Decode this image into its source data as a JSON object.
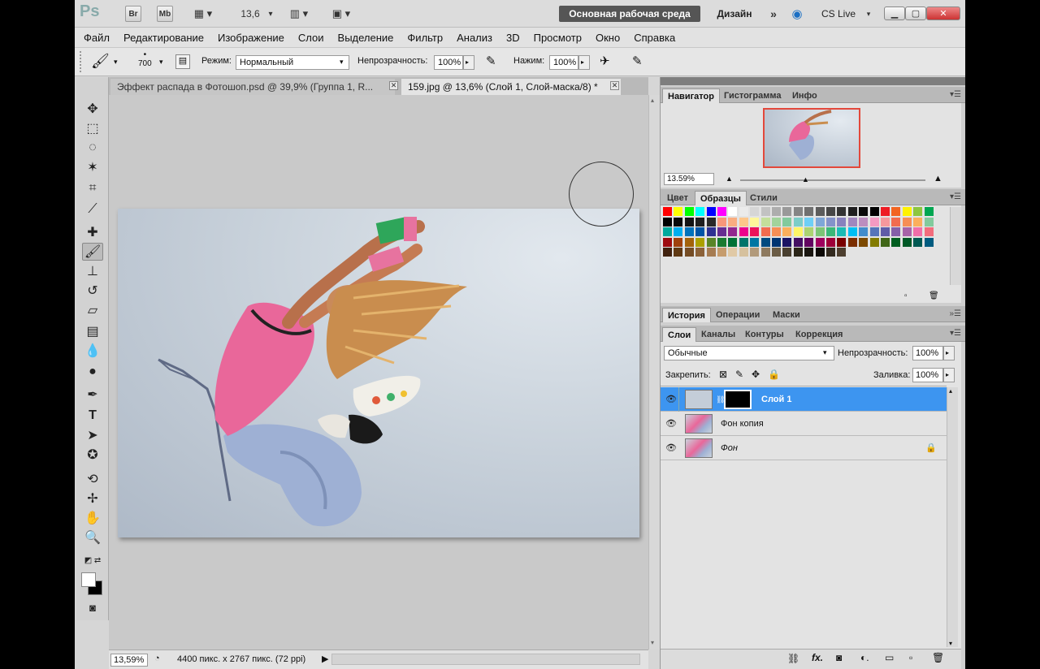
{
  "titlebar": {
    "app_logo": "Ps",
    "zoom": "13,6",
    "workspace_main": "Основная рабочая среда",
    "workspace_design": "Дизайн",
    "workspace_more": "»",
    "cslive": "CS Live",
    "bridge_btn": "Br",
    "minibridge_btn": "Mb"
  },
  "menu": [
    "Файл",
    "Редактирование",
    "Изображение",
    "Слои",
    "Выделение",
    "Фильтр",
    "Анализ",
    "3D",
    "Просмотр",
    "Окно",
    "Справка"
  ],
  "options": {
    "brush_size": "700",
    "mode_label": "Режим:",
    "mode_value": "Нормальный",
    "opacity_label": "Непрозрачность:",
    "opacity_value": "100%",
    "pressure_label": "Нажим:",
    "pressure_value": "100%"
  },
  "documents": [
    {
      "label": "Эффект распада в Фотошоп.psd @ 39,9% (Группа 1, R...",
      "active": false
    },
    {
      "label": "159.jpg @ 13,6% (Слой 1, Слой-маска/8) *",
      "active": true
    }
  ],
  "status": {
    "zoom": "13,59%",
    "doc_info": "4400 пикс. x 2767 пикс. (72 ppi)"
  },
  "navigator": {
    "tabs": [
      "Навигатор",
      "Гистограмма",
      "Инфо"
    ],
    "zoom": "13.59%"
  },
  "swatches_panel": {
    "tabs": [
      "Цвет",
      "Образцы",
      "Стили"
    ]
  },
  "history_panel": {
    "tabs": [
      "История",
      "Операции",
      "Маски"
    ]
  },
  "layers_panel": {
    "tabs": [
      "Слои",
      "Каналы",
      "Контуры",
      "Коррекция"
    ],
    "blend_mode": "Обычные",
    "opacity_label": "Непрозрачность:",
    "opacity_value": "100%",
    "lock_label": "Закрепить:",
    "fill_label": "Заливка:",
    "fill_value": "100%",
    "layers": [
      {
        "name": "Слой 1",
        "selected": true,
        "locked": false
      },
      {
        "name": "Фон копия",
        "selected": false,
        "locked": false
      },
      {
        "name": "Фон",
        "selected": false,
        "locked": true
      }
    ]
  },
  "colors": {
    "accent": "#3d95f0",
    "workspace_btn": "#555555"
  }
}
